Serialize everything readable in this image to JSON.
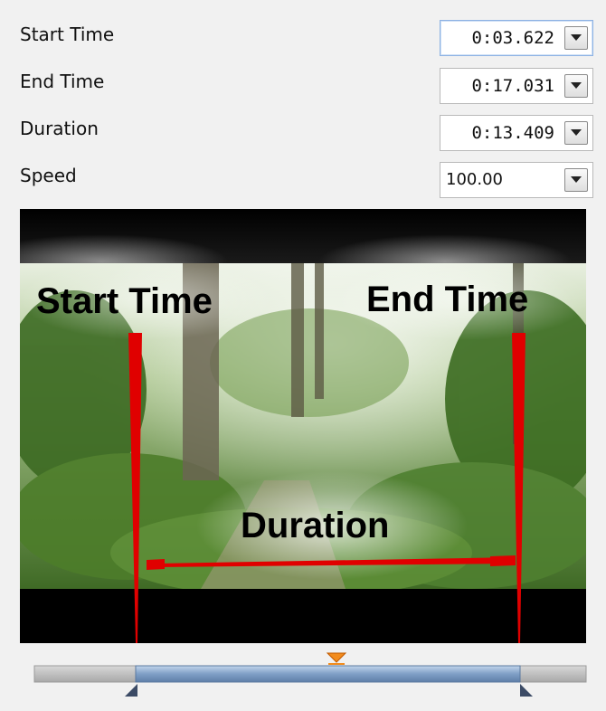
{
  "fields": [
    {
      "label": "Start Time",
      "value": "0:03.622"
    },
    {
      "label": "End Time",
      "value": "0:17.031"
    },
    {
      "label": "Duration",
      "value": "0:13.409"
    },
    {
      "label": "Speed",
      "value": "100.00"
    }
  ],
  "preview": {
    "annotations": {
      "start": "Start Time",
      "end": "End Time",
      "duration": "Duration"
    },
    "marker_color": "#e00000"
  },
  "icons": {
    "dropdown": "chevron-down-icon",
    "playhead": "orange-triangle-icon",
    "trim_handle": "blue-triangle-icon"
  }
}
